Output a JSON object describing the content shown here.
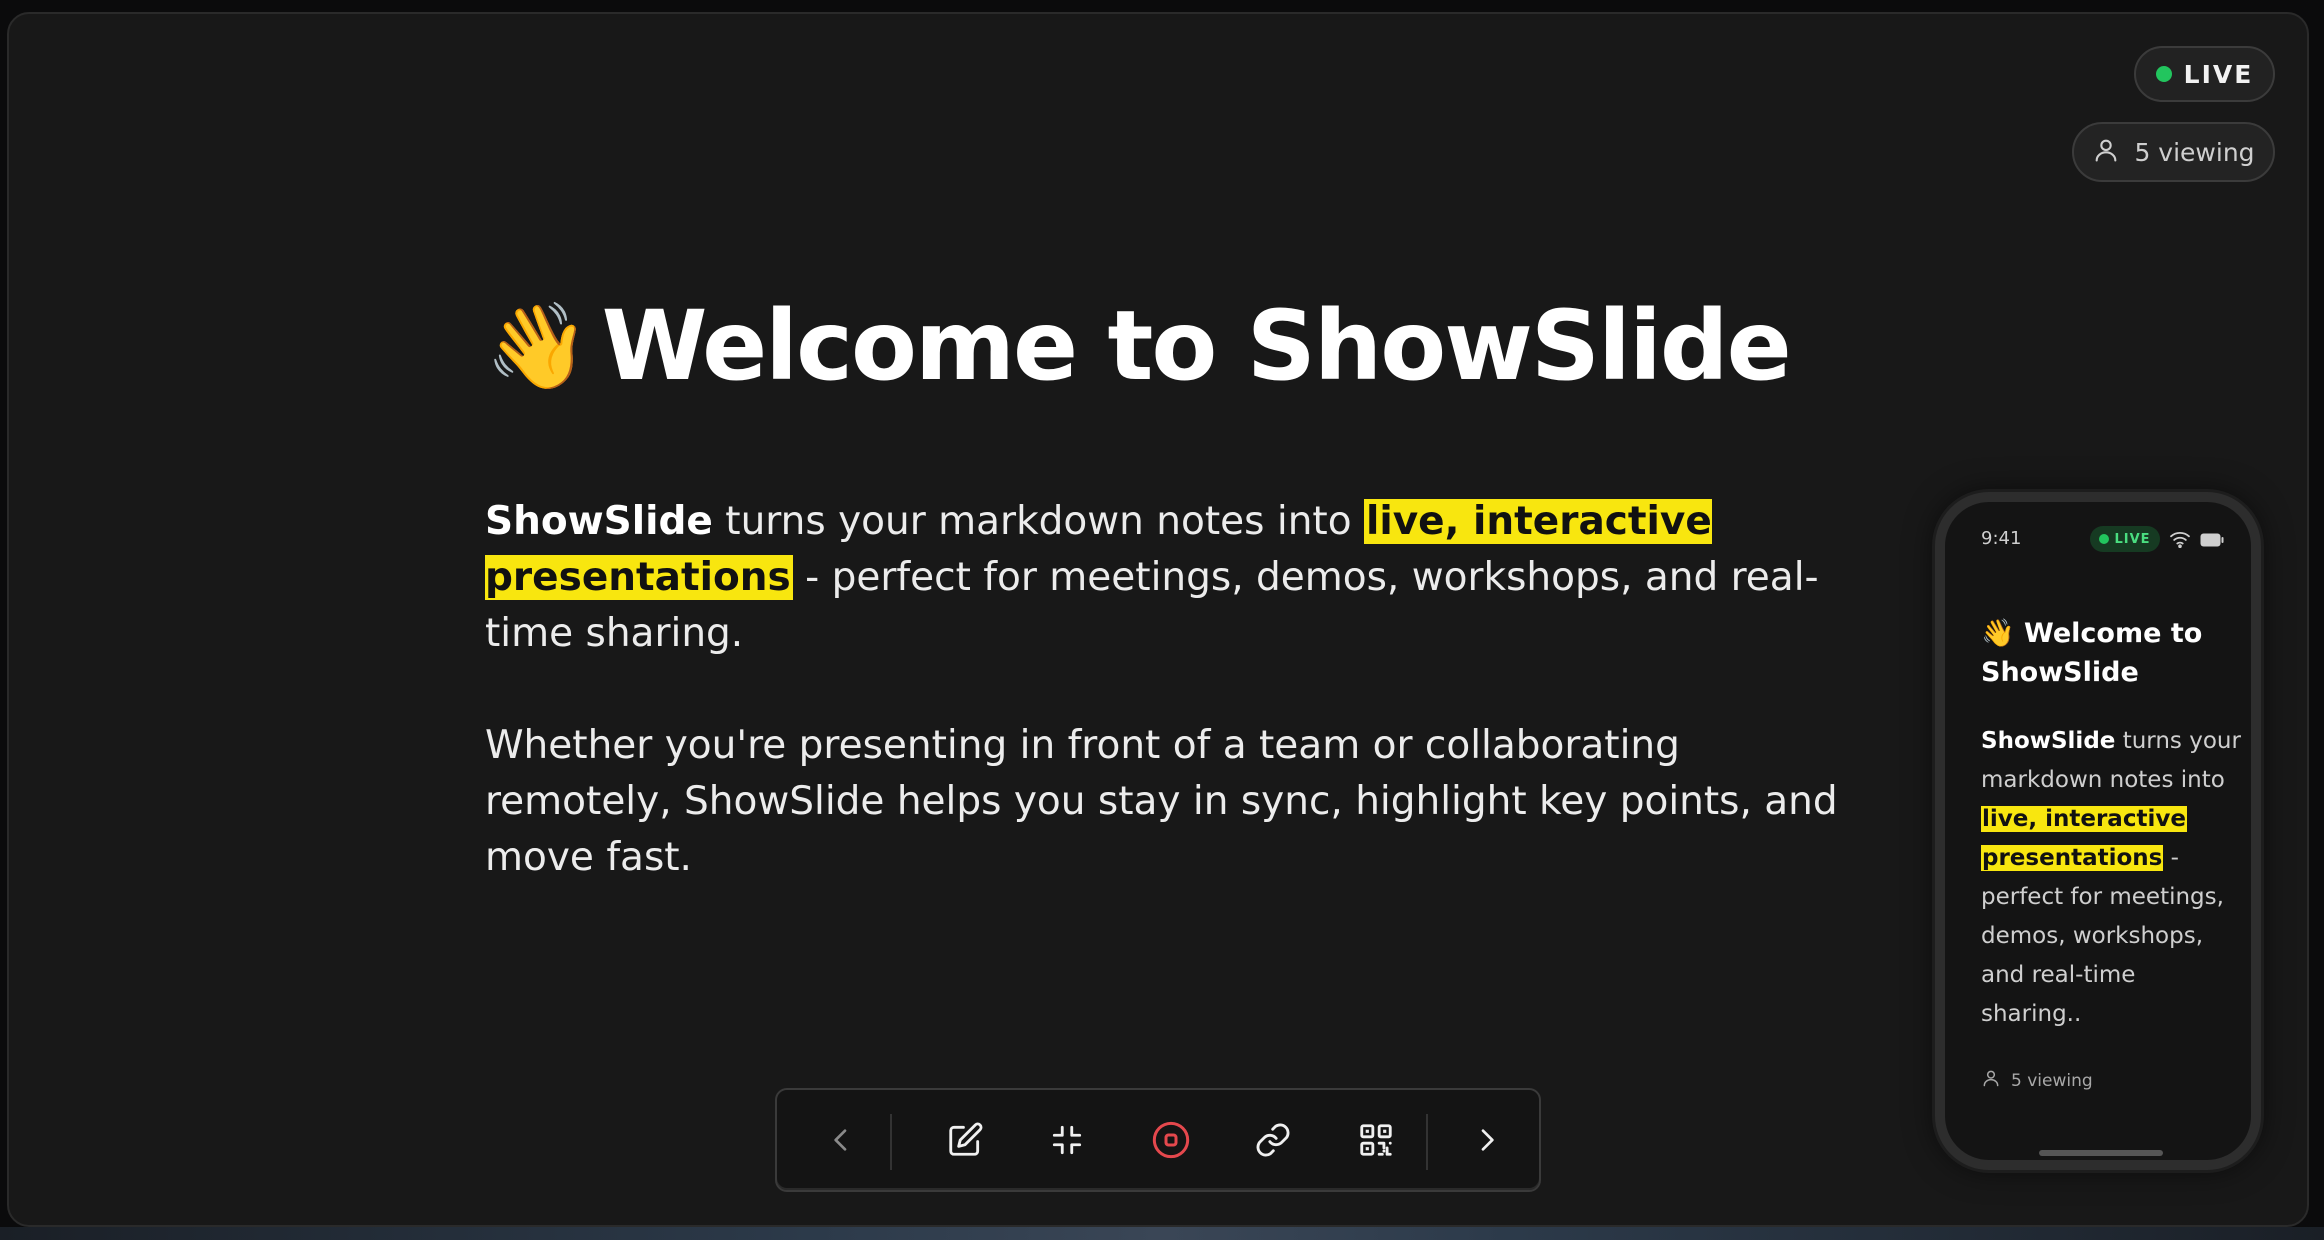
{
  "status": {
    "live_label": "LIVE",
    "viewers_label": "5 viewing"
  },
  "slide": {
    "emoji": "👋",
    "title": "Welcome to ShowSlide",
    "para1": {
      "brand": "ShowSlide",
      "text_a": " turns your markdown notes into ",
      "highlight": "live, interactive presentations",
      "text_b": " - perfect for meetings, demos, workshops, and real-time sharing."
    },
    "para2": "Whether you're presenting in front of a team or collaborating remotely, ShowSlide helps you stay in sync, highlight key points, and move fast."
  },
  "toolbar": {
    "buttons": [
      {
        "name": "previous-slide-button",
        "icon": "chevron-left-icon"
      },
      {
        "name": "edit-button",
        "icon": "pencil-square-icon"
      },
      {
        "name": "exit-fullscreen-button",
        "icon": "minimize-icon"
      },
      {
        "name": "stop-broadcast-button",
        "icon": "stop-record-icon"
      },
      {
        "name": "copy-link-button",
        "icon": "link-icon"
      },
      {
        "name": "qr-code-button",
        "icon": "qr-code-icon"
      },
      {
        "name": "next-slide-button",
        "icon": "chevron-right-icon"
      }
    ]
  },
  "phone": {
    "time": "9:41",
    "live_label": "LIVE",
    "emoji": "👋",
    "title": "Welcome to ShowSlide",
    "brand": "ShowSlide",
    "text_a": " turns your markdown notes into ",
    "highlight_1": "live, interactive",
    "highlight_2": "presentations",
    "text_b": " - perfect for meetings, demos, workshops, and real-time sharing..",
    "viewers_label": "5 viewing"
  },
  "colors": {
    "background": "#181818",
    "highlight": "#f8e60f",
    "live_green": "#22c55e",
    "record_red": "#e5484d"
  }
}
